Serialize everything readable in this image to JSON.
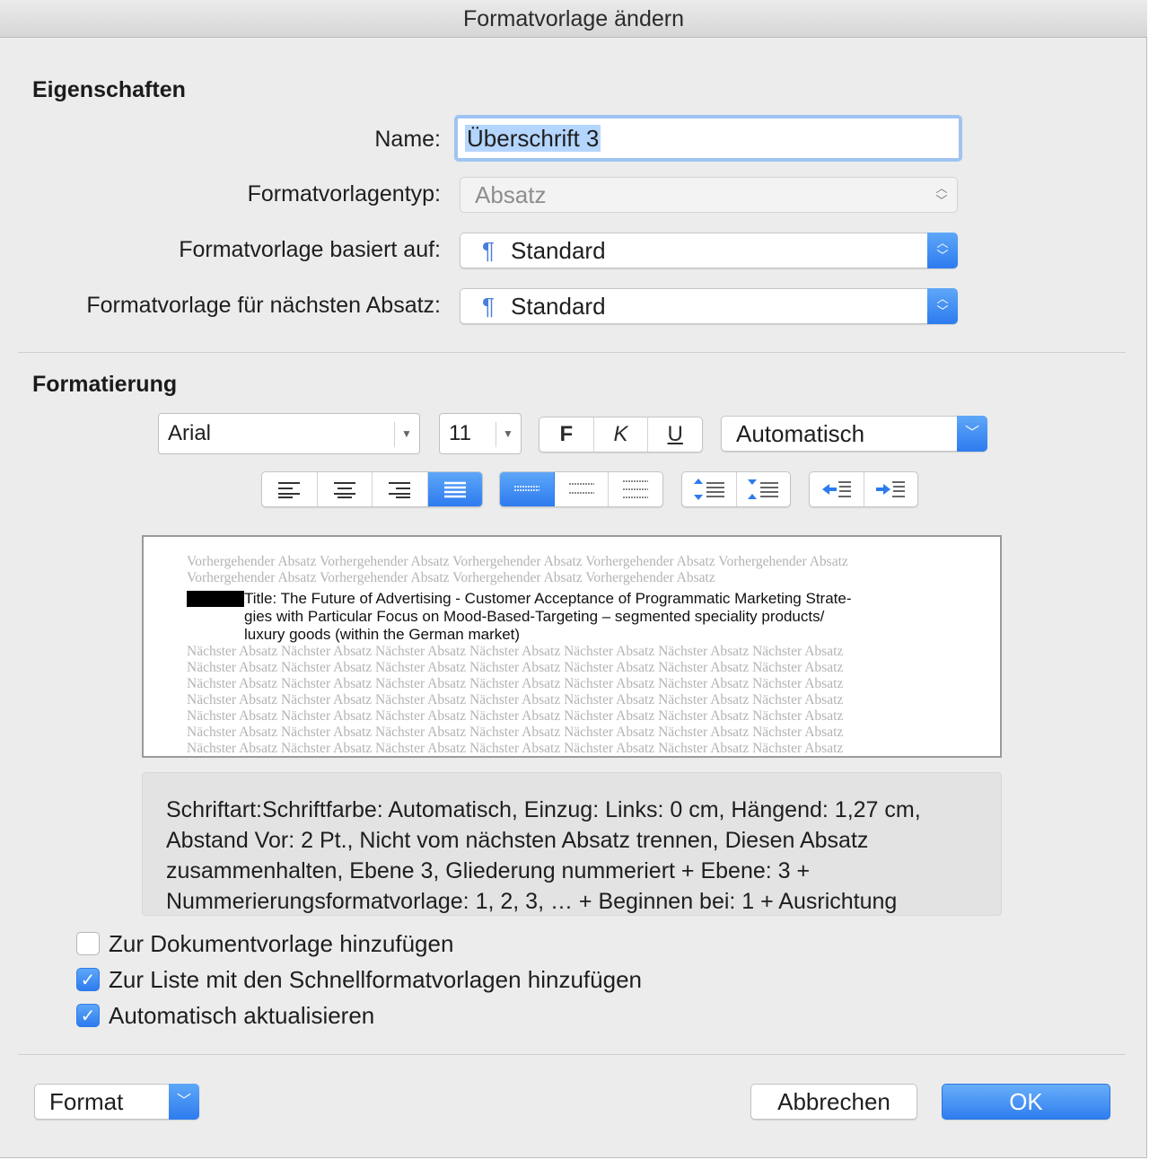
{
  "window": {
    "title": "Formatvorlage ändern"
  },
  "sections": {
    "properties": "Eigenschaften",
    "formatting": "Formatierung"
  },
  "properties": {
    "name_label": "Name:",
    "name_value": "Überschrift 3",
    "type_label": "Formatvorlagentyp:",
    "type_value": "Absatz",
    "based_on_label": "Formatvorlage basiert auf:",
    "based_on_value": "Standard",
    "next_label": "Formatvorlage für nächsten Absatz:",
    "next_value": "Standard",
    "paragraph_glyph": "¶"
  },
  "formatting": {
    "font": "Arial",
    "size": "11",
    "bold": "F",
    "italic": "K",
    "underline": "U",
    "color": "Automatisch",
    "alignment_selected": "justify",
    "line_spacing_selected": "single"
  },
  "preview": {
    "prev_lines": [
      "Vorhergehender Absatz Vorhergehender Absatz Vorhergehender Absatz Vorhergehender Absatz Vorhergehender Absatz",
      "Vorhergehender Absatz Vorhergehender Absatz Vorhergehender Absatz Vorhergehender Absatz"
    ],
    "main_lines": [
      "Title: The Future of Advertising - Customer Acceptance of Programmatic Marketing Strate-",
      "gies  with  Particular  Focus  on  Mood-Based-Targeting  –  segmented  speciality  products/",
      "luxury goods (within the German market)"
    ],
    "next_lines": [
      "Nächster Absatz Nächster Absatz Nächster Absatz Nächster Absatz Nächster Absatz Nächster Absatz Nächster Absatz",
      "Nächster Absatz Nächster Absatz Nächster Absatz Nächster Absatz Nächster Absatz Nächster Absatz Nächster Absatz",
      "Nächster Absatz Nächster Absatz Nächster Absatz Nächster Absatz Nächster Absatz Nächster Absatz Nächster Absatz",
      "Nächster Absatz Nächster Absatz Nächster Absatz Nächster Absatz Nächster Absatz Nächster Absatz Nächster Absatz",
      "Nächster Absatz Nächster Absatz Nächster Absatz Nächster Absatz Nächster Absatz Nächster Absatz Nächster Absatz",
      "Nächster Absatz Nächster Absatz Nächster Absatz Nächster Absatz Nächster Absatz Nächster Absatz Nächster Absatz",
      "Nächster Absatz Nächster Absatz Nächster Absatz Nächster Absatz Nächster Absatz Nächster Absatz Nächster Absatz"
    ]
  },
  "description": "Schriftart:Schriftfarbe: Automatisch, Einzug: Links:  0 cm, Hängend:  1,27 cm, Abstand Vor:  2  Pt., Nicht vom nächsten Absatz trennen, Diesen Absatz zusammenhalten, Ebene 3, Gliederung nummeriert + Ebene: 3 + Nummerierungsformatvorlage: 1, 2, 3, … + Beginnen bei: 1 + Ausrichtung",
  "options": [
    {
      "label": "Zur Dokumentvorlage hinzufügen",
      "checked": false
    },
    {
      "label": "Zur Liste mit den Schnellformatvorlagen hinzufügen",
      "checked": true
    },
    {
      "label": "Automatisch aktualisieren",
      "checked": true
    }
  ],
  "footer": {
    "format_label": "Format",
    "cancel_label": "Abbrechen",
    "ok_label": "OK"
  },
  "colors": {
    "accent": "#2d7bef",
    "selection": "#b4d5fe",
    "dialog_bg": "#ececec"
  }
}
